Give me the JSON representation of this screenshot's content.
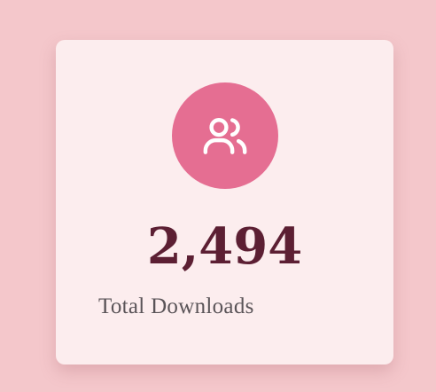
{
  "card": {
    "icon": "users-icon",
    "value": "2,494",
    "label": "Total Downloads"
  },
  "colors": {
    "page_background": "#f4c7cb",
    "card_background": "#fcedee",
    "icon_circle": "#e56e92",
    "value_text": "#5c1f33",
    "label_text": "#5a5458"
  }
}
